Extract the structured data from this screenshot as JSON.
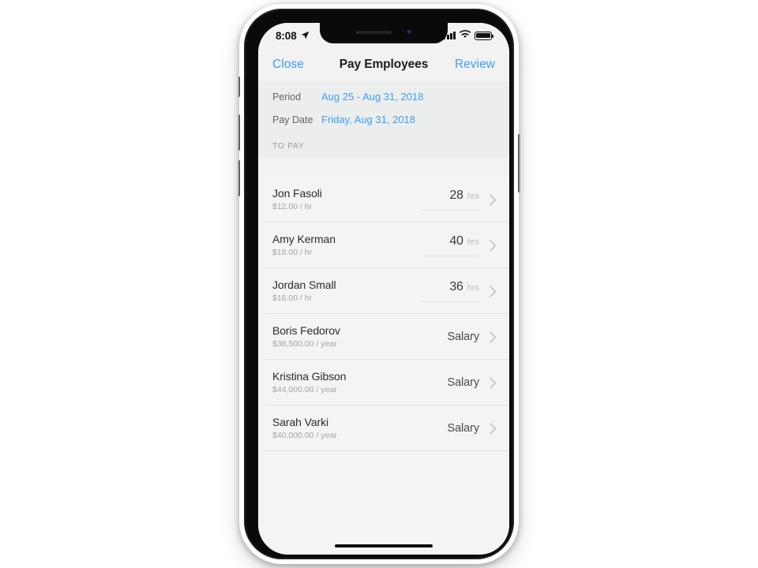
{
  "device": {
    "name": "iphone-x",
    "home_indicator": true
  },
  "status_bar": {
    "time": "8:08",
    "location_arrow_icon": "location-arrow-icon",
    "signal_icon": "cellular-signal-icon",
    "signal_bars": 4,
    "wifi_icon": "wifi-icon",
    "battery_icon": "battery-icon",
    "battery_full": true
  },
  "nav": {
    "close_label": "Close",
    "title": "Pay Employees",
    "review_label": "Review",
    "accent_color": "#3c9ef0"
  },
  "meta": {
    "period_label": "Period",
    "period_value": "Aug 25 - Aug 31, 2018",
    "pay_date_label": "Pay Date",
    "pay_date_value": "Friday, Aug 31, 2018"
  },
  "section": {
    "header": "TO PAY"
  },
  "employees": [
    {
      "name": "Jon Fasoli",
      "rate": "$12.00 / hr",
      "pay_type": "hourly",
      "hours": "28",
      "hours_unit": "hrs",
      "chevron_icon": "chevron-right-icon"
    },
    {
      "name": "Amy Kerman",
      "rate": "$18.00 / hr",
      "pay_type": "hourly",
      "hours": "40",
      "hours_unit": "hrs",
      "chevron_icon": "chevron-right-icon"
    },
    {
      "name": "Jordan Small",
      "rate": "$16.00 / hr",
      "pay_type": "hourly",
      "hours": "36",
      "hours_unit": "hrs",
      "chevron_icon": "chevron-right-icon"
    },
    {
      "name": "Boris Fedorov",
      "rate": "$38,500.00 / year",
      "pay_type": "salary",
      "salary_label": "Salary",
      "chevron_icon": "chevron-right-icon"
    },
    {
      "name": "Kristina Gibson",
      "rate": "$44,000.00 / year",
      "pay_type": "salary",
      "salary_label": "Salary",
      "chevron_icon": "chevron-right-icon"
    },
    {
      "name": "Sarah Varki",
      "rate": "$40,000.00 / year",
      "pay_type": "salary",
      "salary_label": "Salary",
      "chevron_icon": "chevron-right-icon"
    }
  ]
}
